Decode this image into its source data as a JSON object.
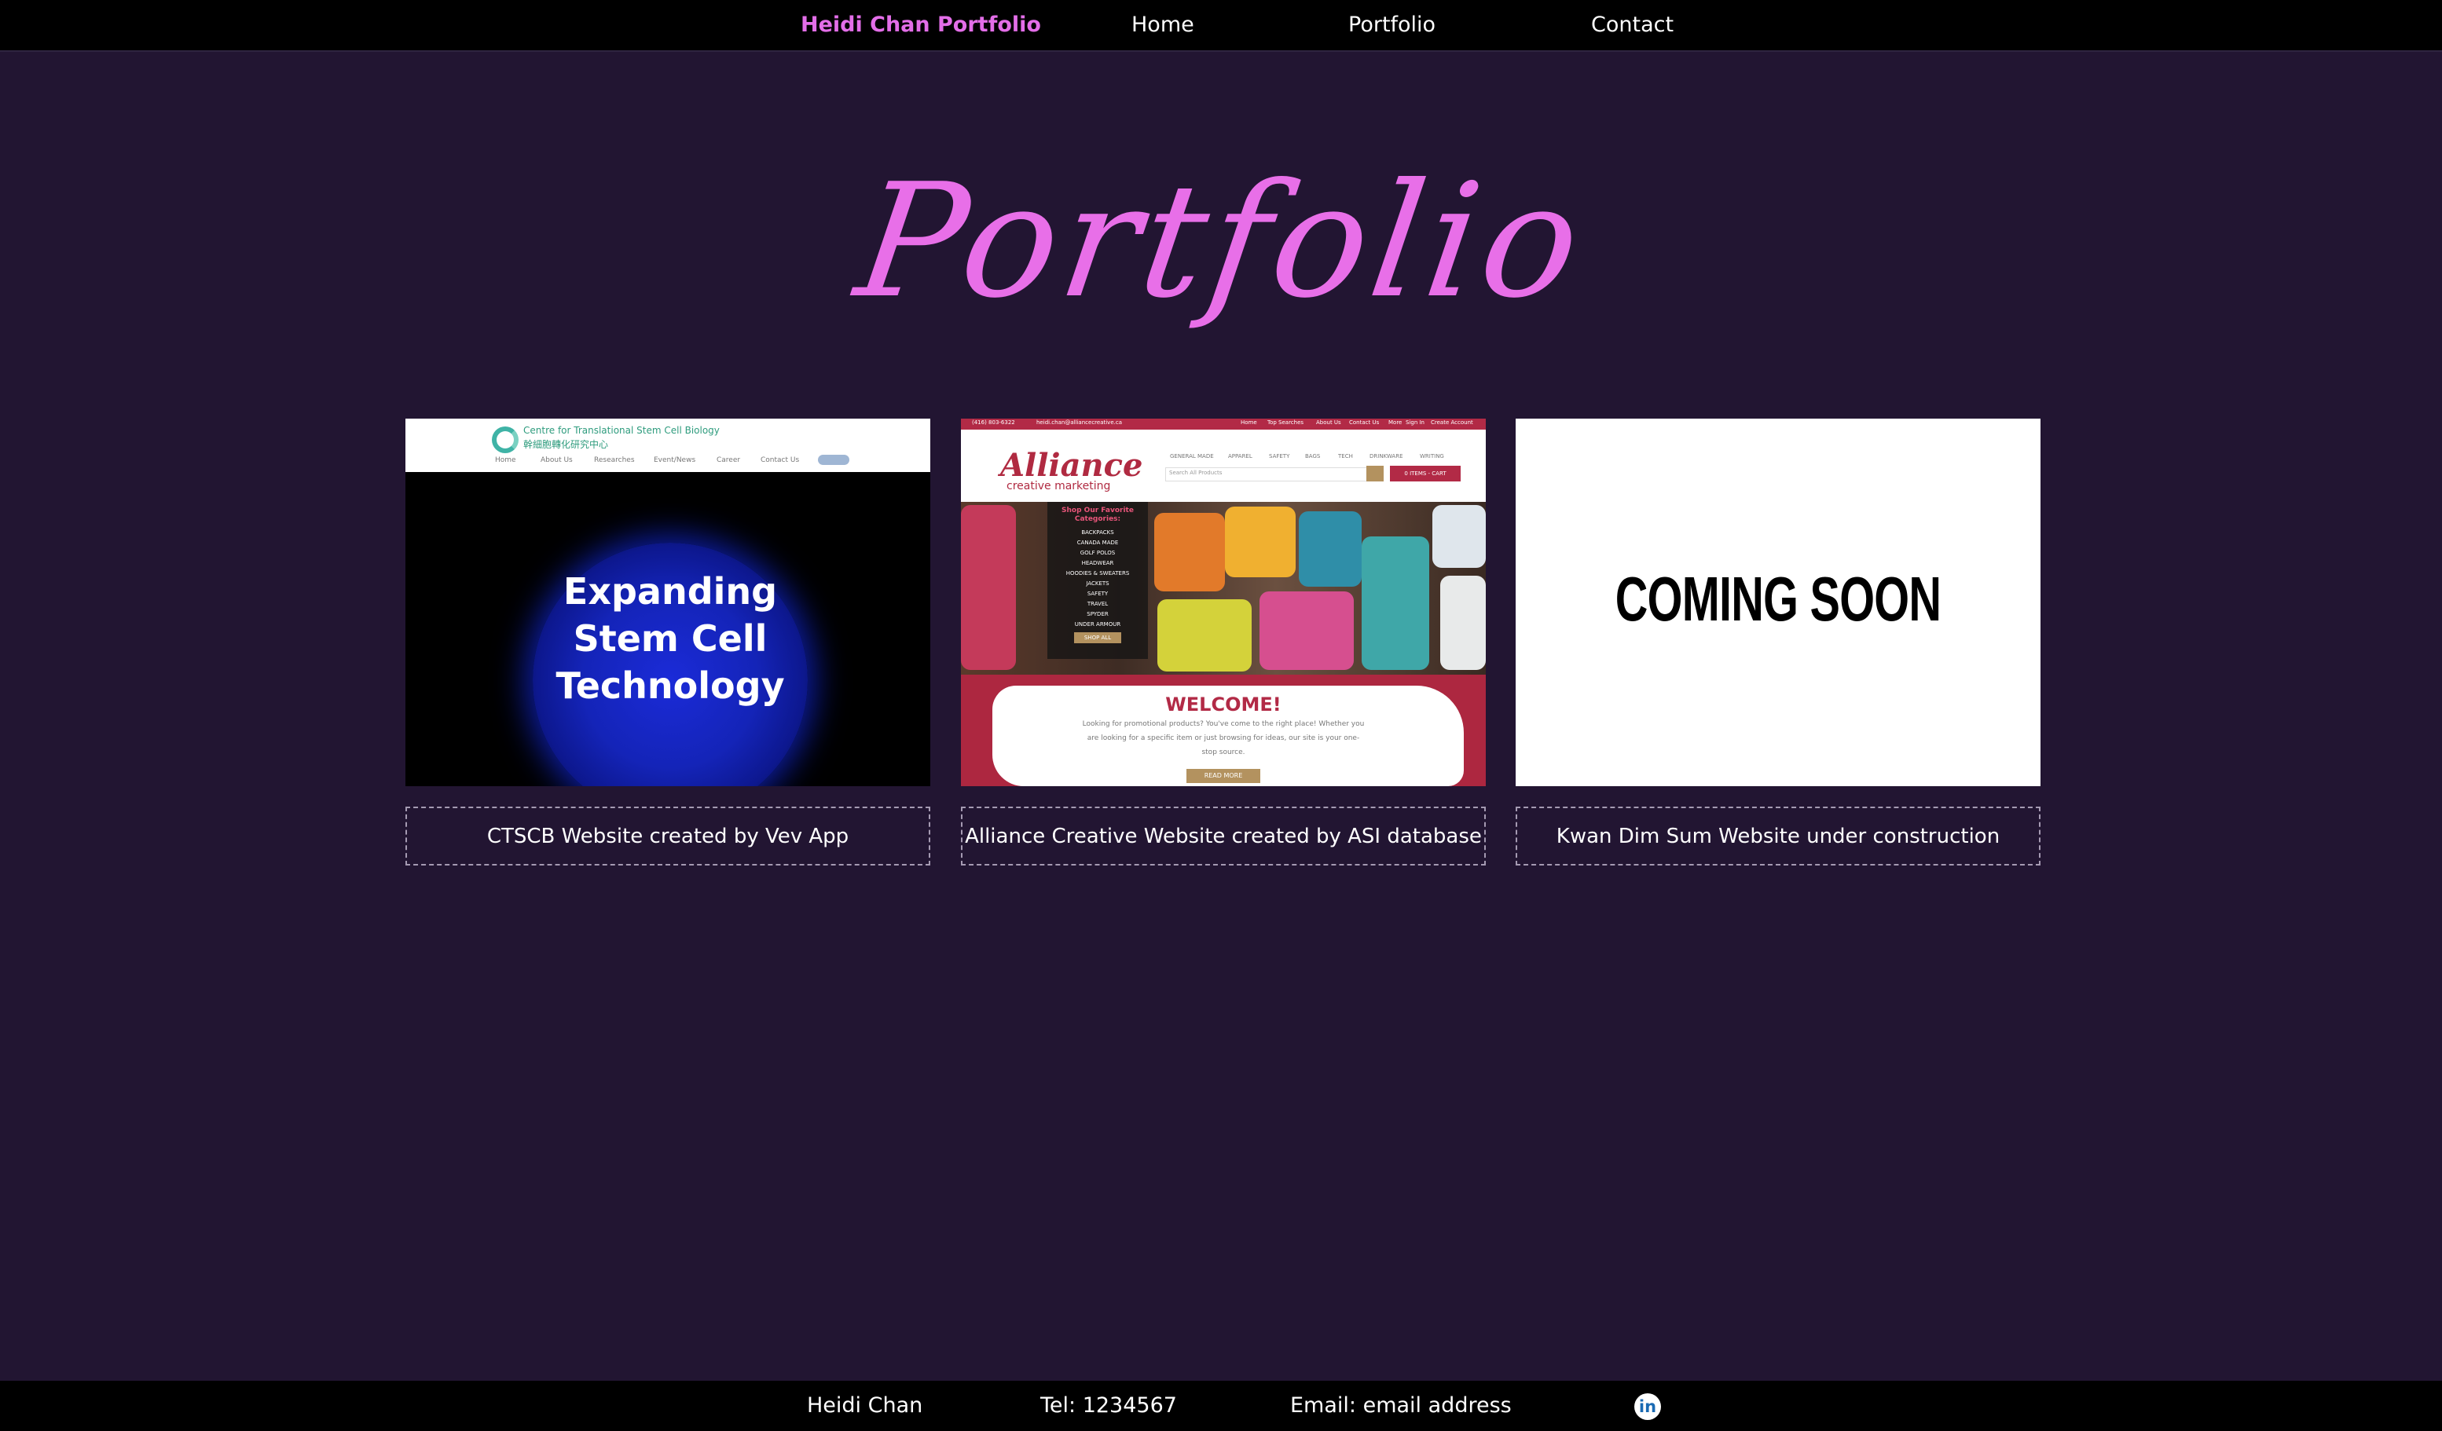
{
  "nav": {
    "brand": "Heidi Chan Portfolio",
    "links": [
      "Home",
      "Portfolio",
      "Contact"
    ]
  },
  "page_title": "Portfolio",
  "cards": [
    {
      "caption": "CTSCB Website created by Vev App",
      "thumb": {
        "org_name": "Centre for Translational Stem Cell Biology",
        "org_name_zh": "幹細胞轉化研究中心",
        "nav": [
          "Home",
          "About Us",
          "Researches",
          "Event/News",
          "Career",
          "Contact Us"
        ],
        "hero_lines": [
          "Expanding",
          "Stem Cell",
          "Technology"
        ]
      }
    },
    {
      "caption": "Alliance Creative Website created by ASI database",
      "thumb": {
        "phone": "(416) 803-6322",
        "email": "heidi.chan@alliancecreative.ca",
        "top_links": [
          "Home",
          "Top Searches",
          "About Us",
          "Contact Us",
          "More",
          "Sign In",
          "Create Account"
        ],
        "logo": "Alliance",
        "logo_sub": "creative marketing",
        "menu": [
          "GENERAL MADE",
          "APPAREL",
          "SAFETY",
          "BAGS",
          "TECH",
          "DRINKWARE",
          "WRITING"
        ],
        "search_placeholder": "Search All Products",
        "cart": "0 ITEMS - CART",
        "categories_title": "Shop Our Favorite Categories:",
        "categories": [
          "BACKPACKS",
          "CANADA MADE",
          "GOLF POLOS",
          "HEADWEAR",
          "HOODIES & SWEATERS",
          "JACKETS",
          "SAFETY",
          "TRAVEL",
          "SPYDER",
          "UNDER ARMOUR"
        ],
        "shop_all": "SHOP ALL",
        "welcome": "WELCOME!",
        "welcome_lines": [
          "Looking for promotional products? You've come to the right place! Whether you",
          "are looking for a specific item or just browsing for ideas, our site is your one-",
          "stop source."
        ],
        "read_more": "READ MORE"
      }
    },
    {
      "caption": "Kwan Dim Sum Website under construction",
      "thumb": {
        "text": "COMING SOON"
      }
    }
  ],
  "footer": {
    "name": "Heidi Chan",
    "tel": "Tel: 1234567",
    "email": "Email: email address",
    "linkedin_icon": "linkedin-icon"
  }
}
